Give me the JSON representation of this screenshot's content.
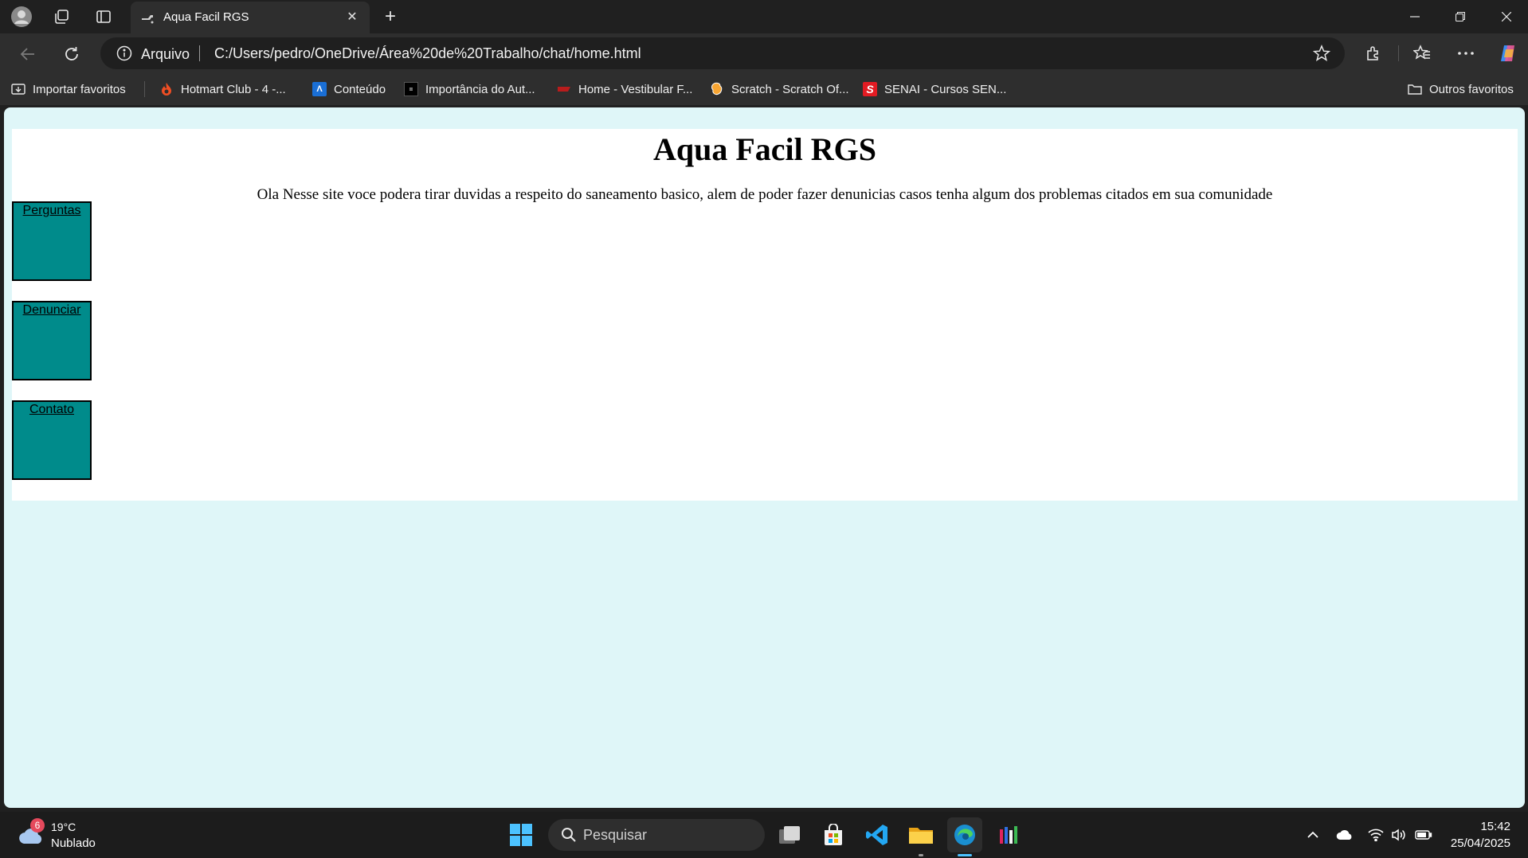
{
  "browser": {
    "tab_title": "Aqua Facil RGS",
    "tab_close": "✕",
    "new_tab": "+",
    "address_label": "Arquivo",
    "url": "C:/Users/pedro/OneDrive/Área%20de%20Trabalho/chat/home.html"
  },
  "bookmarks": {
    "import": "Importar favoritos",
    "items": [
      {
        "label": "Hotmart Club - 4 -...",
        "icon": "flame-icon",
        "color": "#f04e23"
      },
      {
        "label": "Conteúdo",
        "icon": "a-logo-icon",
        "color": "#1a6fd6"
      },
      {
        "label": "Importância do Aut...",
        "icon": "dark-square-icon",
        "color": "#111111"
      },
      {
        "label": "Home - Vestibular F...",
        "icon": "red-logo-icon",
        "color": "#c41e1e"
      },
      {
        "label": "Scratch - Scratch Of...",
        "icon": "scratch-cat-icon",
        "color": "#f7a532"
      },
      {
        "label": "SENAI - Cursos SEN...",
        "icon": "senai-s-icon",
        "color": "#e31b23"
      }
    ],
    "other": "Outros favoritos"
  },
  "page": {
    "title": "Aqua Facil RGS",
    "intro": "Ola Nesse site voce podera tirar duvidas a respeito do saneamento basico, alem de poder fazer denunicias casos tenha algum dos problemas citados em sua comunidade",
    "nav": [
      {
        "label": "Perguntas"
      },
      {
        "label": "Denunciar"
      },
      {
        "label": "Contato"
      }
    ],
    "colors": {
      "background": "#dff6f8",
      "box": "#008b8b"
    }
  },
  "taskbar": {
    "weather_badge": "6",
    "temperature": "19°C",
    "condition": "Nublado",
    "search_placeholder": "Pesquisar",
    "time": "15:42",
    "date": "25/04/2025"
  }
}
